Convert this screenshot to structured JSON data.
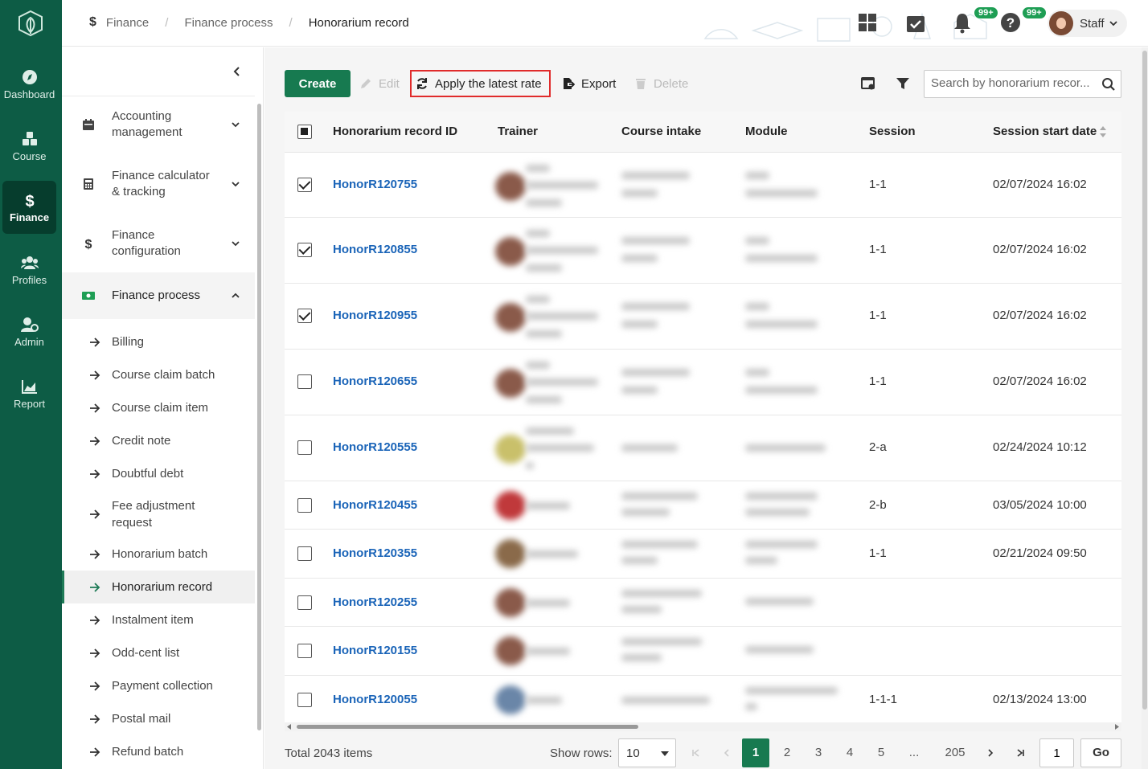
{
  "rail": {
    "items": [
      {
        "label": "Dashboard",
        "icon": "compass-icon"
      },
      {
        "label": "Course",
        "icon": "cubes-icon"
      },
      {
        "label": "Finance",
        "icon": "dollar-icon",
        "active": true
      },
      {
        "label": "Profiles",
        "icon": "users-icon"
      },
      {
        "label": "Admin",
        "icon": "user-gear-icon"
      },
      {
        "label": "Report",
        "icon": "chart-icon"
      }
    ]
  },
  "header": {
    "breadcrumb": [
      "Finance",
      "Finance process",
      "Honorarium record"
    ],
    "task_badge": "99+",
    "notif_badge": "99+",
    "user_label": "Staff"
  },
  "sidebar": {
    "groups": [
      {
        "label": "Accounting management",
        "icon": "calendar-icon"
      },
      {
        "label": "Finance calculator & tracking",
        "icon": "calculator-icon"
      },
      {
        "label": "Finance configuration",
        "icon": "dollar-icon"
      },
      {
        "label": "Finance process",
        "icon": "money-icon",
        "open": true
      }
    ],
    "items": [
      "Billing",
      "Course claim batch",
      "Course claim item",
      "Credit note",
      "Doubtful debt",
      "Fee adjustment request",
      "Honorarium batch",
      "Honorarium record",
      "Instalment item",
      "Odd-cent list",
      "Payment collection",
      "Postal mail",
      "Refund batch"
    ],
    "active_item": "Honorarium record"
  },
  "toolbar": {
    "create": "Create",
    "edit": "Edit",
    "apply_rate": "Apply the latest rate",
    "export": "Export",
    "delete": "Delete",
    "search_placeholder": "Search by honorarium recor..."
  },
  "table": {
    "columns": [
      "Honorarium record ID",
      "Trainer",
      "Course intake",
      "Module",
      "Session",
      "Session start date"
    ],
    "rows": [
      {
        "id": "HonorR120755",
        "session": "1-1",
        "start": "02/07/2024 16:02",
        "checked": true
      },
      {
        "id": "HonorR120855",
        "session": "1-1",
        "start": "02/07/2024 16:02",
        "checked": true
      },
      {
        "id": "HonorR120955",
        "session": "1-1",
        "start": "02/07/2024 16:02",
        "checked": true
      },
      {
        "id": "HonorR120655",
        "session": "1-1",
        "start": "02/07/2024 16:02",
        "checked": false
      },
      {
        "id": "HonorR120555",
        "session": "2-a",
        "start": "02/24/2024 10:12",
        "checked": false
      },
      {
        "id": "HonorR120455",
        "session": "2-b",
        "start": "03/05/2024 10:00",
        "checked": false
      },
      {
        "id": "HonorR120355",
        "session": "1-1",
        "start": "02/21/2024 09:50",
        "checked": false
      },
      {
        "id": "HonorR120255",
        "session": "",
        "start": "",
        "checked": false
      },
      {
        "id": "HonorR120155",
        "session": "",
        "start": "",
        "checked": false
      },
      {
        "id": "HonorR120055",
        "session": "1-1-1",
        "start": "02/13/2024 13:00",
        "checked": false
      }
    ]
  },
  "footer": {
    "total": "Total 2043 items",
    "show_rows_label": "Show rows:",
    "rows_per_page": "10",
    "pages": [
      "1",
      "2",
      "3",
      "4",
      "5",
      "...",
      "205"
    ],
    "current_page": "1",
    "goto_value": "1",
    "go": "Go"
  },
  "colors": {
    "rail_bg": "#0d5c45",
    "primary": "#177a50",
    "link": "#1a64b8",
    "highlight_border": "#e02b2b",
    "badge": "#1e9e54"
  }
}
